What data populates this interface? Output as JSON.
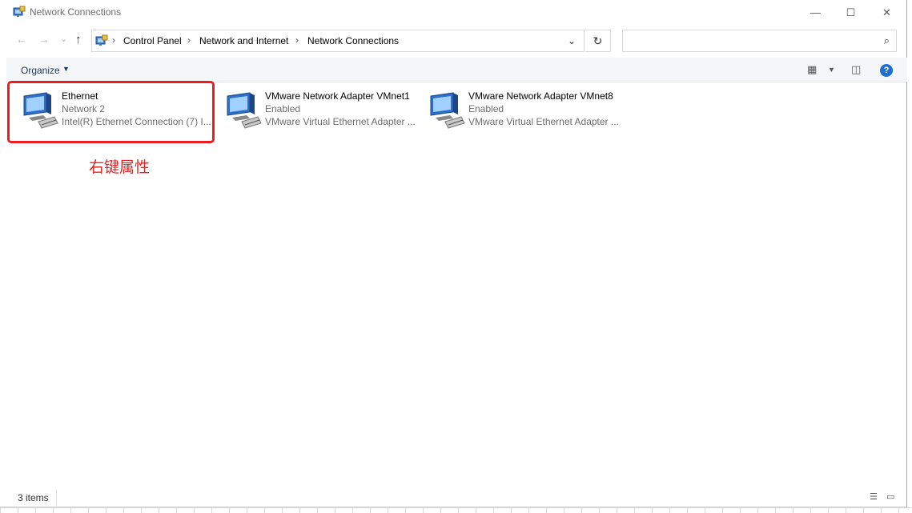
{
  "window": {
    "title": "Network Connections",
    "controls": {
      "minimize": "—",
      "maximize": "☐",
      "close": "✕"
    }
  },
  "nav": {
    "back": "←",
    "forward": "→",
    "recent": "⌄",
    "up": "↑",
    "breadcrumb": [
      "Control Panel",
      "Network and Internet",
      "Network Connections"
    ],
    "separator": "›",
    "dropdown": "⌄",
    "refresh": "↻",
    "search_placeholder": "",
    "search_icon": "⌕"
  },
  "toolbar": {
    "organize_label": "Organize",
    "caret": "▼",
    "view_icon": "▦",
    "view_caret": "▼",
    "pane_icon": "◫",
    "help_label": "?"
  },
  "items": [
    {
      "name": "Ethernet",
      "status": "Network 2",
      "device": "Intel(R) Ethernet Connection (7) I..."
    },
    {
      "name": "VMware Network Adapter VMnet1",
      "status": "Enabled",
      "device": "VMware Virtual Ethernet Adapter ..."
    },
    {
      "name": "VMware Network Adapter VMnet8",
      "status": "Enabled",
      "device": "VMware Virtual Ethernet Adapter ..."
    }
  ],
  "annotation": "右键属性",
  "statusbar": {
    "count": "3 items",
    "details_view_icon": "☰",
    "large_icons_icon": "▭"
  },
  "colors": {
    "highlight": "#ee1c1c",
    "annotation": "#e8231f",
    "help": "#1f6fd1"
  }
}
